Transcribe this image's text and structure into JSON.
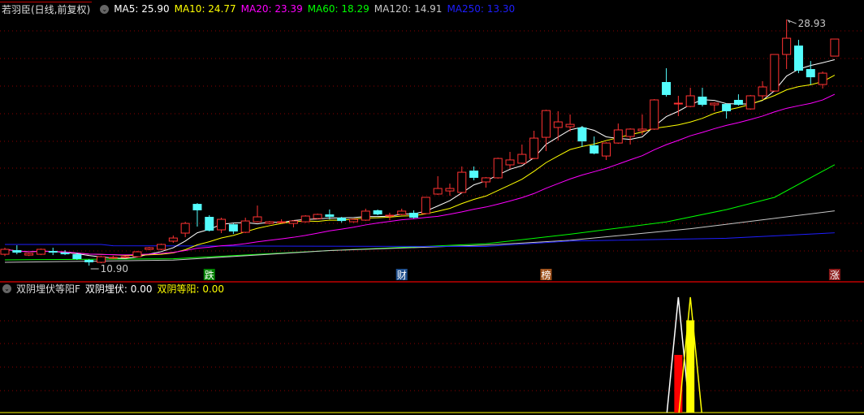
{
  "header": {
    "title": "若羽臣(日线,前复权)",
    "ma": [
      {
        "label": "MA5: 25.90",
        "color": "#ffffff"
      },
      {
        "label": "MA10: 24.77",
        "color": "#ffff00"
      },
      {
        "label": "MA20: 23.39",
        "color": "#ff00ff"
      },
      {
        "label": "MA60: 18.29",
        "color": "#00ff00"
      },
      {
        "label": "MA120: 14.91",
        "color": "#c8c8c8"
      },
      {
        "label": "MA250: 13.30",
        "color": "#1e1eff"
      }
    ]
  },
  "sub_header": {
    "title": "双阴埋伏等阳F",
    "item1": "双阴埋伏: 0.00",
    "item2": "双阴等阳: 0.00"
  },
  "colors": {
    "up": "#ff3232",
    "down": "#54fcfc",
    "grid": "#8b0000",
    "separator": "#c00000"
  },
  "chart_data": [
    {
      "type": "candlestick",
      "title": "若羽臣(日线,前复权)",
      "ylim": [
        9.83,
        30.36
      ],
      "high_label": "28.93",
      "low_label": "10.90",
      "high_index": 65,
      "low_index": 7,
      "ohlc": [
        [
          11.73,
          12.21,
          11.6,
          12.09
        ],
        [
          12.03,
          12.39,
          11.73,
          11.85
        ],
        [
          11.67,
          11.85,
          11.6,
          11.79
        ],
        [
          11.73,
          12.15,
          11.67,
          12.09
        ],
        [
          11.97,
          12.21,
          11.67,
          11.85
        ],
        [
          11.85,
          12.03,
          11.67,
          11.73
        ],
        [
          11.73,
          11.85,
          11.32,
          11.38
        ],
        [
          11.32,
          11.38,
          10.9,
          11.14
        ],
        [
          11.14,
          11.62,
          11.08,
          11.55
        ],
        [
          11.5,
          11.62,
          11.38,
          11.5
        ],
        [
          11.5,
          11.62,
          11.45,
          11.55
        ],
        [
          11.55,
          11.97,
          11.5,
          11.91
        ],
        [
          12.09,
          12.27,
          12.03,
          12.21
        ],
        [
          12.09,
          12.51,
          12.03,
          12.45
        ],
        [
          12.69,
          13.1,
          12.57,
          12.92
        ],
        [
          13.28,
          14.11,
          12.98,
          13.99
        ],
        [
          15.42,
          15.48,
          13.76,
          14.95
        ],
        [
          14.47,
          14.59,
          13.4,
          13.46
        ],
        [
          13.52,
          14.41,
          13.28,
          14.29
        ],
        [
          13.93,
          13.99,
          13.22,
          13.4
        ],
        [
          13.34,
          14.41,
          13.28,
          14.17
        ],
        [
          14.11,
          15.3,
          14.05,
          14.47
        ],
        [
          13.99,
          14.17,
          13.93,
          14.11
        ],
        [
          14.11,
          14.29,
          13.99,
          14.11
        ],
        [
          13.99,
          14.23,
          13.7,
          14.17
        ],
        [
          14.11,
          14.59,
          14.05,
          14.53
        ],
        [
          14.35,
          14.71,
          14.29,
          14.65
        ],
        [
          14.65,
          15.01,
          14.29,
          14.47
        ],
        [
          14.41,
          14.47,
          14.05,
          14.17
        ],
        [
          14.11,
          14.35,
          14.05,
          14.29
        ],
        [
          14.23,
          15.07,
          14.17,
          14.89
        ],
        [
          14.95,
          15.01,
          14.59,
          14.65
        ],
        [
          14.59,
          14.77,
          14.23,
          14.59
        ],
        [
          14.65,
          15.07,
          14.59,
          14.89
        ],
        [
          14.77,
          14.95,
          14.35,
          14.41
        ],
        [
          14.71,
          15.9,
          14.65,
          15.9
        ],
        [
          16.14,
          17.45,
          16.08,
          16.55
        ],
        [
          16.37,
          16.91,
          16.02,
          16.55
        ],
        [
          16.26,
          18.16,
          16.2,
          17.74
        ],
        [
          17.86,
          18.16,
          17.15,
          17.33
        ],
        [
          17.03,
          17.39,
          16.61,
          17.33
        ],
        [
          17.33,
          18.81,
          17.27,
          18.75
        ],
        [
          18.28,
          19.23,
          17.98,
          18.64
        ],
        [
          18.4,
          19.77,
          18.34,
          19.05
        ],
        [
          18.75,
          20.78,
          18.69,
          20.24
        ],
        [
          20.3,
          22.32,
          19.29,
          22.26
        ],
        [
          21.02,
          22.21,
          20.06,
          21.43
        ],
        [
          21.07,
          21.97,
          20.72,
          21.25
        ],
        [
          21.02,
          21.13,
          19.59,
          20.0
        ],
        [
          19.71,
          20.36,
          19.05,
          19.11
        ],
        [
          18.93,
          19.94,
          18.64,
          19.88
        ],
        [
          19.88,
          21.31,
          19.82,
          20.84
        ],
        [
          20.36,
          20.96,
          19.77,
          20.9
        ],
        [
          20.78,
          21.97,
          20.48,
          20.9
        ],
        [
          20.9,
          23.1,
          20.84,
          23.04
        ],
        [
          24.35,
          25.36,
          23.28,
          23.4
        ],
        [
          22.8,
          23.34,
          21.85,
          22.8
        ],
        [
          22.56,
          23.93,
          22.5,
          23.34
        ],
        [
          23.28,
          23.93,
          22.56,
          22.68
        ],
        [
          22.68,
          22.86,
          22.21,
          22.8
        ],
        [
          22.74,
          22.8,
          21.67,
          22.21
        ],
        [
          23.04,
          23.45,
          22.62,
          22.68
        ],
        [
          22.38,
          23.4,
          22.32,
          23.34
        ],
        [
          23.34,
          24.41,
          23.1,
          23.99
        ],
        [
          23.69,
          26.37,
          23.63,
          26.37
        ],
        [
          26.37,
          28.93,
          25.3,
          27.56
        ],
        [
          27.02,
          27.44,
          25.0,
          25.18
        ],
        [
          25.3,
          25.89,
          24.17,
          24.7
        ],
        [
          24.17,
          25.12,
          23.87,
          25.0
        ],
        [
          26.25,
          27.5,
          26.25,
          27.5
        ]
      ],
      "ohlc_order": [
        "open",
        "high",
        "low",
        "close"
      ],
      "ma_computed": [
        {
          "name": "MA5",
          "period": 5,
          "color": "#ffffff"
        },
        {
          "name": "MA10",
          "period": 10,
          "color": "#ffff00"
        },
        {
          "name": "MA20",
          "period": 20,
          "color": "#ff00ff"
        }
      ],
      "ma_series": [
        {
          "name": "MA60",
          "color": "#00ff00",
          "points": [
            [
              0,
              11.32
            ],
            [
              14,
              11.4
            ],
            [
              27,
              12.0
            ],
            [
              40,
              12.5
            ],
            [
              47,
              13.2
            ],
            [
              55,
              14.1
            ],
            [
              60,
              15.0
            ],
            [
              64,
              15.9
            ],
            [
              69,
              18.29
            ]
          ]
        },
        {
          "name": "MA120",
          "color": "#c8c8c8",
          "points": [
            [
              0,
              11.14
            ],
            [
              14,
              11.3
            ],
            [
              27,
              12.0
            ],
            [
              40,
              12.4
            ],
            [
              47,
              12.75
            ],
            [
              57,
              13.6
            ],
            [
              69,
              14.91
            ]
          ]
        },
        {
          "name": "MA250",
          "color": "#1e1eff",
          "points": [
            [
              0,
              12.45
            ],
            [
              8,
              12.45
            ],
            [
              9,
              12.35
            ],
            [
              40,
              12.3
            ],
            [
              47,
              12.7
            ],
            [
              60,
              12.9
            ],
            [
              69,
              13.3
            ]
          ]
        }
      ],
      "markers": [
        {
          "index": 17,
          "text": "跌",
          "color": "#008000"
        },
        {
          "index": 33,
          "text": "财",
          "color": "#1f4e8c"
        },
        {
          "index": 45,
          "text": "榜",
          "color": "#a0521c"
        },
        {
          "index": 69,
          "text": "涨",
          "color": "#8b1a1a"
        }
      ]
    },
    {
      "type": "bar",
      "title": "双阴埋伏等阳F",
      "ylim": [
        0,
        1.1
      ],
      "series": [
        {
          "name": "双阴埋伏",
          "color": "#ff0000",
          "bars": [
            {
              "index": 56,
              "value": 0.5
            }
          ],
          "spike": {
            "index": 56,
            "value": 1.0,
            "color": "#ffffff"
          }
        },
        {
          "name": "双阴等阳",
          "color": "#ffff00",
          "bars": [
            {
              "index": 57,
              "value": 0.8
            }
          ],
          "spike": {
            "index": 57,
            "value": 1.0,
            "color": "#ffff00"
          }
        }
      ]
    }
  ]
}
